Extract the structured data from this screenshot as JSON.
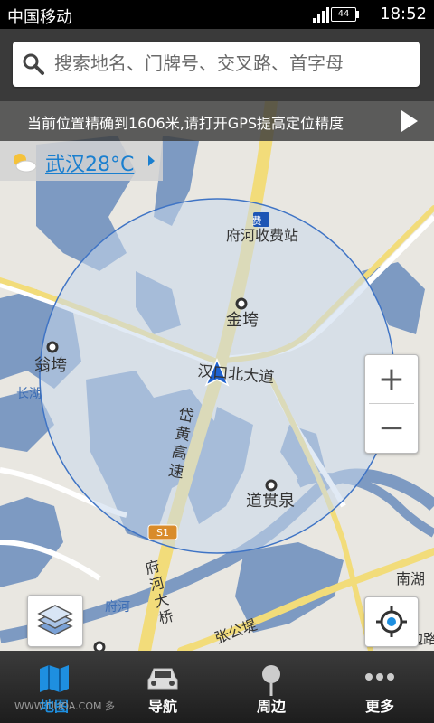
{
  "status_bar": {
    "carrier": "中国移动",
    "battery": "44",
    "time": "18:52"
  },
  "search": {
    "placeholder": "搜索地名、门牌号、交叉路、首字母"
  },
  "gps_banner": {
    "text": "当前位置精确到1606米,请打开GPS提高定位精度"
  },
  "weather": {
    "text": "武汉28°C",
    "icon": "partly-cloudy-icon"
  },
  "map": {
    "labels": {
      "toll_badge": "费",
      "toll_station": "府河收费站",
      "jinwan": "金垮",
      "wengwan": "翁垮",
      "changhu": "长湖",
      "hankou_road": "汉口北大道",
      "expressway": "岱黄高速",
      "daoguanquan": "道贯泉",
      "s1": "S1",
      "fuhe_bridge": "府河大桥",
      "fuhe": "府河",
      "zhanggongdi": "张公堤",
      "nanhu": "南湖",
      "tibian": "提边路"
    },
    "colors": {
      "land": "#e9e7e1",
      "water": "#7d9ac2",
      "major_road": "#f2dc7a",
      "accuracy_circle": "#c8d8ec",
      "accent": "#1e8fe0"
    }
  },
  "controls": {
    "zoom_in": "+",
    "zoom_out": "−"
  },
  "bottom_nav": {
    "items": [
      {
        "label": "地图",
        "icon": "map-icon",
        "active": true
      },
      {
        "label": "导航",
        "icon": "car-icon",
        "active": false
      },
      {
        "label": "周边",
        "icon": "pin-icon",
        "active": false
      },
      {
        "label": "更多",
        "icon": "more-dots-icon",
        "active": false
      }
    ]
  },
  "watermark": "WWW.DUOA.COM 多"
}
